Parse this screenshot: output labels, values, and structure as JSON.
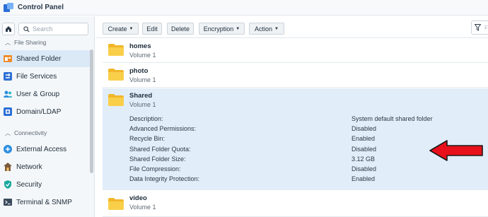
{
  "window": {
    "title": "Control Panel"
  },
  "sidebar": {
    "search_placeholder": "Search",
    "sections": [
      {
        "label": "File Sharing"
      },
      {
        "label": "Connectivity"
      }
    ],
    "items": [
      {
        "label": "Shared Folder",
        "icon": "shared-folder-icon",
        "active": true
      },
      {
        "label": "File Services",
        "icon": "file-services-icon"
      },
      {
        "label": "User & Group",
        "icon": "user-group-icon"
      },
      {
        "label": "Domain/LDAP",
        "icon": "domain-ldap-icon"
      },
      {
        "label": "External Access",
        "icon": "external-access-icon"
      },
      {
        "label": "Network",
        "icon": "network-icon"
      },
      {
        "label": "Security",
        "icon": "security-icon"
      },
      {
        "label": "Terminal & SNMP",
        "icon": "terminal-icon"
      }
    ]
  },
  "toolbar": {
    "create": "Create",
    "edit": "Edit",
    "delete": "Delete",
    "encryption": "Encryption",
    "action": "Action",
    "filter_placeholder": "F"
  },
  "folders": [
    {
      "name": "homes",
      "volume": "Volume 1"
    },
    {
      "name": "photo",
      "volume": "Volume 1"
    },
    {
      "name": "Shared",
      "volume": "Volume 1",
      "expanded": true,
      "details": [
        {
          "label": "Description:",
          "value": "System default shared folder"
        },
        {
          "label": "Advanced Permissions:",
          "value": "Disabled"
        },
        {
          "label": "Recycle Bin:",
          "value": "Enabled"
        },
        {
          "label": "Shared Folder Quota:",
          "value": "Disabled"
        },
        {
          "label": "Shared Folder Size:",
          "value": "3.12 GB"
        },
        {
          "label": "File Compression:",
          "value": "Disabled"
        },
        {
          "label": "Data Integrity Protection:",
          "value": "Enabled"
        }
      ]
    },
    {
      "name": "video",
      "volume": "Volume 1"
    }
  ],
  "colors": {
    "accent": "#2d6fd6",
    "selected_row": "#e1edf9",
    "folder_yellow": "#f7c948",
    "annotation_arrow": "#e8101a"
  }
}
